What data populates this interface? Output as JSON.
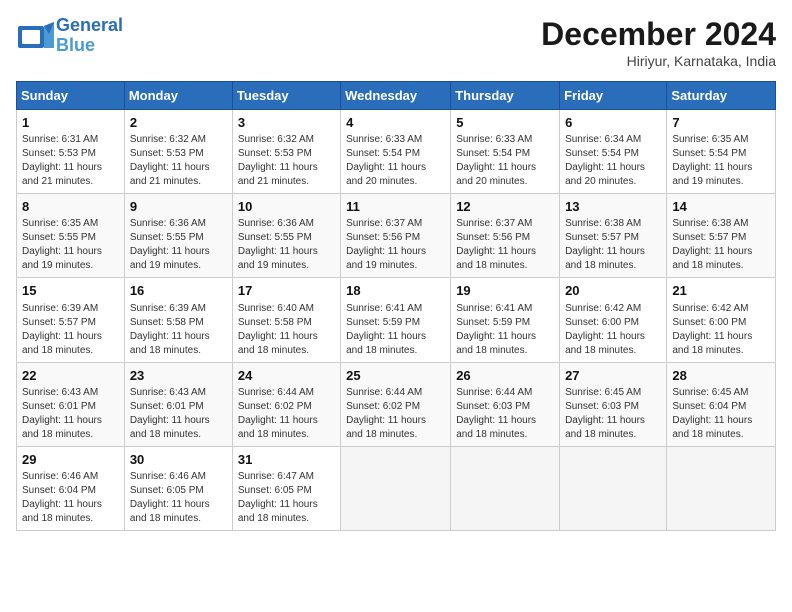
{
  "header": {
    "logo_line1": "General",
    "logo_line2": "Blue",
    "month": "December 2024",
    "location": "Hiriyur, Karnataka, India"
  },
  "days_of_week": [
    "Sunday",
    "Monday",
    "Tuesday",
    "Wednesday",
    "Thursday",
    "Friday",
    "Saturday"
  ],
  "weeks": [
    [
      {
        "day": "1",
        "info": "Sunrise: 6:31 AM\nSunset: 5:53 PM\nDaylight: 11 hours\nand 21 minutes."
      },
      {
        "day": "2",
        "info": "Sunrise: 6:32 AM\nSunset: 5:53 PM\nDaylight: 11 hours\nand 21 minutes."
      },
      {
        "day": "3",
        "info": "Sunrise: 6:32 AM\nSunset: 5:53 PM\nDaylight: 11 hours\nand 21 minutes."
      },
      {
        "day": "4",
        "info": "Sunrise: 6:33 AM\nSunset: 5:54 PM\nDaylight: 11 hours\nand 20 minutes."
      },
      {
        "day": "5",
        "info": "Sunrise: 6:33 AM\nSunset: 5:54 PM\nDaylight: 11 hours\nand 20 minutes."
      },
      {
        "day": "6",
        "info": "Sunrise: 6:34 AM\nSunset: 5:54 PM\nDaylight: 11 hours\nand 20 minutes."
      },
      {
        "day": "7",
        "info": "Sunrise: 6:35 AM\nSunset: 5:54 PM\nDaylight: 11 hours\nand 19 minutes."
      }
    ],
    [
      {
        "day": "8",
        "info": "Sunrise: 6:35 AM\nSunset: 5:55 PM\nDaylight: 11 hours\nand 19 minutes."
      },
      {
        "day": "9",
        "info": "Sunrise: 6:36 AM\nSunset: 5:55 PM\nDaylight: 11 hours\nand 19 minutes."
      },
      {
        "day": "10",
        "info": "Sunrise: 6:36 AM\nSunset: 5:55 PM\nDaylight: 11 hours\nand 19 minutes."
      },
      {
        "day": "11",
        "info": "Sunrise: 6:37 AM\nSunset: 5:56 PM\nDaylight: 11 hours\nand 19 minutes."
      },
      {
        "day": "12",
        "info": "Sunrise: 6:37 AM\nSunset: 5:56 PM\nDaylight: 11 hours\nand 18 minutes."
      },
      {
        "day": "13",
        "info": "Sunrise: 6:38 AM\nSunset: 5:57 PM\nDaylight: 11 hours\nand 18 minutes."
      },
      {
        "day": "14",
        "info": "Sunrise: 6:38 AM\nSunset: 5:57 PM\nDaylight: 11 hours\nand 18 minutes."
      }
    ],
    [
      {
        "day": "15",
        "info": "Sunrise: 6:39 AM\nSunset: 5:57 PM\nDaylight: 11 hours\nand 18 minutes."
      },
      {
        "day": "16",
        "info": "Sunrise: 6:39 AM\nSunset: 5:58 PM\nDaylight: 11 hours\nand 18 minutes."
      },
      {
        "day": "17",
        "info": "Sunrise: 6:40 AM\nSunset: 5:58 PM\nDaylight: 11 hours\nand 18 minutes."
      },
      {
        "day": "18",
        "info": "Sunrise: 6:41 AM\nSunset: 5:59 PM\nDaylight: 11 hours\nand 18 minutes."
      },
      {
        "day": "19",
        "info": "Sunrise: 6:41 AM\nSunset: 5:59 PM\nDaylight: 11 hours\nand 18 minutes."
      },
      {
        "day": "20",
        "info": "Sunrise: 6:42 AM\nSunset: 6:00 PM\nDaylight: 11 hours\nand 18 minutes."
      },
      {
        "day": "21",
        "info": "Sunrise: 6:42 AM\nSunset: 6:00 PM\nDaylight: 11 hours\nand 18 minutes."
      }
    ],
    [
      {
        "day": "22",
        "info": "Sunrise: 6:43 AM\nSunset: 6:01 PM\nDaylight: 11 hours\nand 18 minutes."
      },
      {
        "day": "23",
        "info": "Sunrise: 6:43 AM\nSunset: 6:01 PM\nDaylight: 11 hours\nand 18 minutes."
      },
      {
        "day": "24",
        "info": "Sunrise: 6:44 AM\nSunset: 6:02 PM\nDaylight: 11 hours\nand 18 minutes."
      },
      {
        "day": "25",
        "info": "Sunrise: 6:44 AM\nSunset: 6:02 PM\nDaylight: 11 hours\nand 18 minutes."
      },
      {
        "day": "26",
        "info": "Sunrise: 6:44 AM\nSunset: 6:03 PM\nDaylight: 11 hours\nand 18 minutes."
      },
      {
        "day": "27",
        "info": "Sunrise: 6:45 AM\nSunset: 6:03 PM\nDaylight: 11 hours\nand 18 minutes."
      },
      {
        "day": "28",
        "info": "Sunrise: 6:45 AM\nSunset: 6:04 PM\nDaylight: 11 hours\nand 18 minutes."
      }
    ],
    [
      {
        "day": "29",
        "info": "Sunrise: 6:46 AM\nSunset: 6:04 PM\nDaylight: 11 hours\nand 18 minutes."
      },
      {
        "day": "30",
        "info": "Sunrise: 6:46 AM\nSunset: 6:05 PM\nDaylight: 11 hours\nand 18 minutes."
      },
      {
        "day": "31",
        "info": "Sunrise: 6:47 AM\nSunset: 6:05 PM\nDaylight: 11 hours\nand 18 minutes."
      },
      null,
      null,
      null,
      null
    ]
  ]
}
